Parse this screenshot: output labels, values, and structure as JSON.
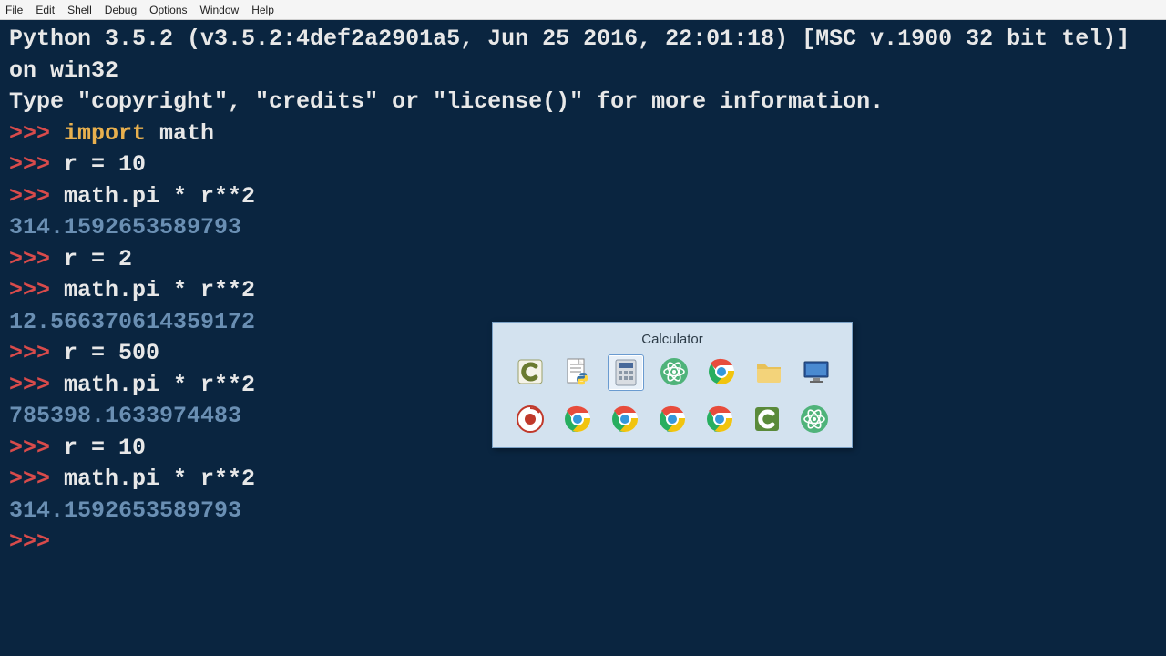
{
  "menu": {
    "items": [
      "File",
      "Edit",
      "Shell",
      "Debug",
      "Options",
      "Window",
      "Help"
    ]
  },
  "terminal": {
    "banner_l1": "Python 3.5.2 (v3.5.2:4def2a2901a5, Jun 25 2016, 22:01:18) [MSC v.1900 32 bit tel)] on win32",
    "banner_l2": "Type \"copyright\", \"credits\" or \"license()\" for more information.",
    "lines": [
      {
        "t": "in",
        "kw": "import",
        "rest": " math"
      },
      {
        "t": "in",
        "txt": "r = 10"
      },
      {
        "t": "in",
        "txt": "math.pi * r**2"
      },
      {
        "t": "out",
        "txt": "314.1592653589793"
      },
      {
        "t": "in",
        "txt": "r = 2"
      },
      {
        "t": "in",
        "txt": "math.pi * r**2"
      },
      {
        "t": "out",
        "txt": "12.566370614359172"
      },
      {
        "t": "in",
        "txt": "r = 500"
      },
      {
        "t": "in",
        "txt": "math.pi * r**2"
      },
      {
        "t": "out",
        "txt": "785398.1633974483"
      },
      {
        "t": "in",
        "txt": "r = 10"
      },
      {
        "t": "in",
        "txt": "math.pi * r**2"
      },
      {
        "t": "out",
        "txt": "314.1592653589793"
      },
      {
        "t": "in",
        "txt": ""
      }
    ],
    "prompt": ">>> "
  },
  "switcher": {
    "title": "Calculator",
    "row1": [
      {
        "name": "camtasia-icon",
        "kind": "camtasia",
        "sel": false
      },
      {
        "name": "python-file-icon",
        "kind": "pyfile",
        "sel": false
      },
      {
        "name": "calculator-icon",
        "kind": "calc",
        "sel": true
      },
      {
        "name": "atom-icon",
        "kind": "atom-green",
        "sel": false
      },
      {
        "name": "chrome-icon",
        "kind": "chrome",
        "sel": false
      },
      {
        "name": "folder-icon",
        "kind": "folder",
        "sel": false
      },
      {
        "name": "monitor-icon",
        "kind": "monitor",
        "sel": false
      }
    ],
    "row2": [
      {
        "name": "recorder-icon",
        "kind": "rec",
        "sel": false
      },
      {
        "name": "chrome-icon",
        "kind": "chrome",
        "sel": false
      },
      {
        "name": "chrome-icon",
        "kind": "chrome",
        "sel": false
      },
      {
        "name": "chrome-icon",
        "kind": "chrome",
        "sel": false
      },
      {
        "name": "chrome-icon",
        "kind": "chrome",
        "sel": false
      },
      {
        "name": "camtasia-green-icon",
        "kind": "camtasia-g",
        "sel": false
      },
      {
        "name": "atom-icon",
        "kind": "atom-green",
        "sel": false
      }
    ]
  },
  "colors": {
    "bg": "#0a2540",
    "prompt": "#d94b4b",
    "keyword": "#e8b04e",
    "text": "#e8e8e8",
    "output": "#6a8fb3",
    "switcher_bg": "#d3e2ef",
    "switcher_border": "#7aa0c4"
  }
}
